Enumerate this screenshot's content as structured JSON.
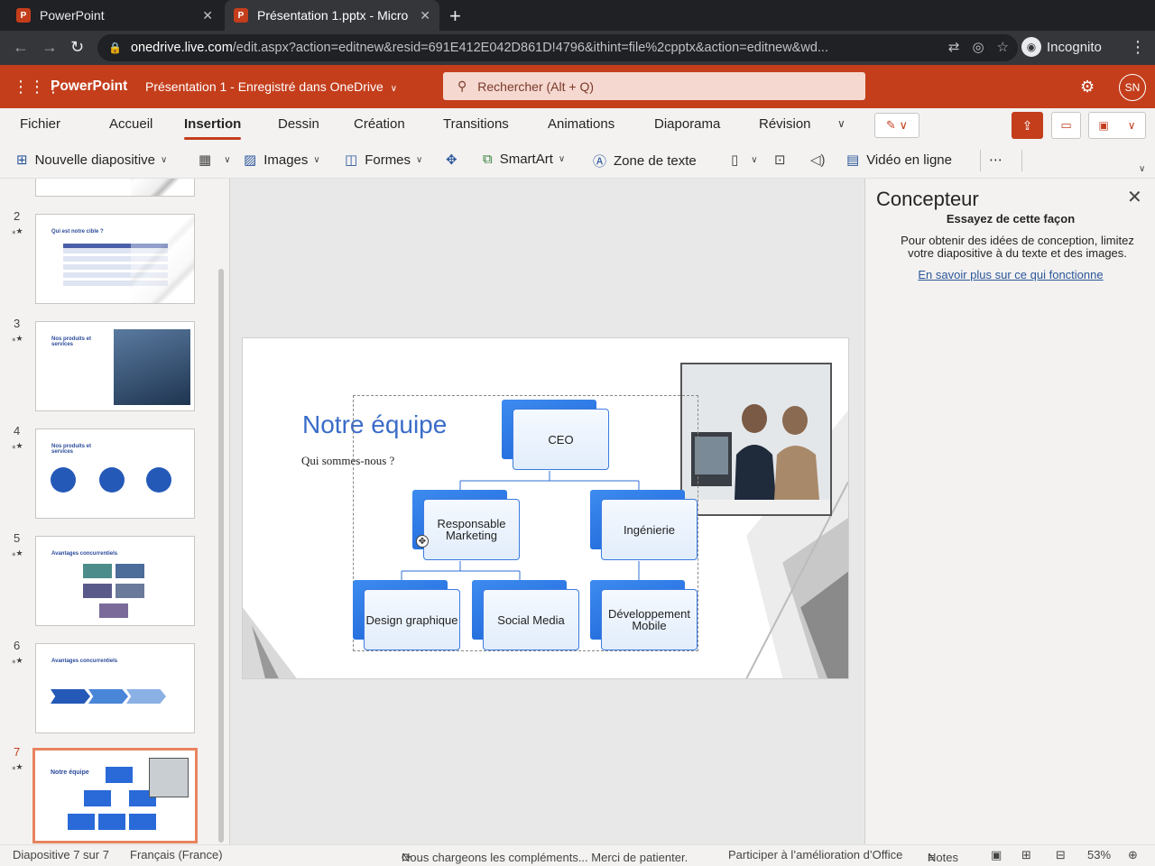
{
  "browser": {
    "tabs": [
      {
        "title": "PowerPoint",
        "favicon": "P"
      },
      {
        "title": "Présentation 1.pptx - Micro",
        "favicon": "P"
      }
    ],
    "url_host": "onedrive.live.com",
    "url_path": "/edit.aspx?action=editnew&resid=691E412E042D861D!4796&ithint=file%2cpptx&action=editnew&wd...",
    "incognito_label": "Incognito"
  },
  "office": {
    "app_name": "PowerPoint",
    "doc_title": "Présentation 1  -  Enregistré dans OneDrive",
    "search_placeholder": "Rechercher (Alt + Q)",
    "avatar_initials": "SN",
    "brand_color": "#c43e1c"
  },
  "ribbon": {
    "tabs": [
      "Fichier",
      "Accueil",
      "Insertion",
      "Dessin",
      "Création",
      "Transitions",
      "Animations",
      "Diaporama",
      "Révision"
    ],
    "active_tab": "Insertion",
    "commands": {
      "new_slide": "Nouvelle diapositive",
      "images": "Images",
      "shapes": "Formes",
      "smartart": "SmartArt",
      "textbox": "Zone de texte",
      "online_video": "Vidéo en ligne"
    }
  },
  "thumbnails": [
    {
      "num": "2",
      "title": "Qui est notre cible ?"
    },
    {
      "num": "3",
      "title": "Nos produits et services"
    },
    {
      "num": "4",
      "title": "Nos produits et services"
    },
    {
      "num": "5",
      "title": "Avantages concurrentiels"
    },
    {
      "num": "6",
      "title": "Avantages concurrentiels"
    },
    {
      "num": "7",
      "title": "Notre équipe"
    }
  ],
  "slide": {
    "title": "Notre équipe",
    "subtitle": "Qui sommes-nous ?",
    "org_chart": {
      "ceo": "CEO",
      "marketing": "Responsable Marketing",
      "engineering": "Ingénierie",
      "design": "Design graphique",
      "social": "Social Media",
      "mobile": "Développement Mobile"
    }
  },
  "designer": {
    "title": "Concepteur",
    "try_label": "Essayez de cette façon",
    "description": "Pour obtenir des idées de conception, limitez votre diapositive à du texte et des images.",
    "learn_more": "En savoir plus sur ce qui fonctionne"
  },
  "status": {
    "slide_count": "Diapositive 7 sur 7",
    "language": "Français (France)",
    "loading": "Nous chargeons les compléments... Merci de patienter.",
    "feedback": "Participer à l’amélioration d’Office",
    "notes": "Notes",
    "zoom": "53%"
  }
}
